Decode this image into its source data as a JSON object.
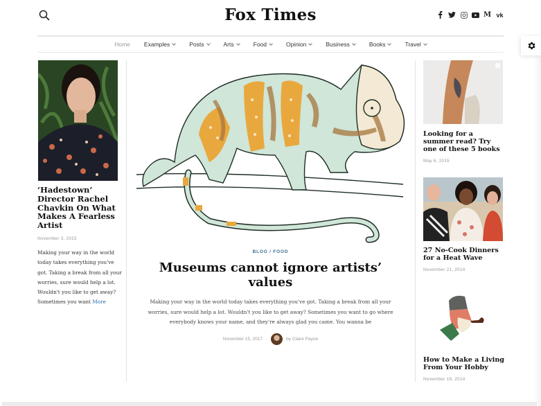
{
  "header": {
    "logo": "Fox Times",
    "search_icon": "search-icon",
    "social": [
      {
        "name": "facebook-icon",
        "glyph": "f"
      },
      {
        "name": "twitter-icon",
        "glyph": "t"
      },
      {
        "name": "instagram-icon",
        "glyph": "i"
      },
      {
        "name": "youtube-icon",
        "glyph": "y"
      },
      {
        "name": "medium-icon",
        "glyph": "M"
      },
      {
        "name": "vk-icon",
        "glyph": "vk"
      }
    ]
  },
  "nav": {
    "items": [
      {
        "label": "Home",
        "dropdown": false
      },
      {
        "label": "Examples",
        "dropdown": true
      },
      {
        "label": "Posts",
        "dropdown": true
      },
      {
        "label": "Arts",
        "dropdown": true
      },
      {
        "label": "Food",
        "dropdown": true
      },
      {
        "label": "Opinion",
        "dropdown": true
      },
      {
        "label": "Business",
        "dropdown": true
      },
      {
        "label": "Books",
        "dropdown": true
      },
      {
        "label": "Travel",
        "dropdown": true
      }
    ]
  },
  "settings": {
    "icon": "gear-icon"
  },
  "left_post": {
    "title": "‘Hadestown’ Director Rachel Chavkin On What Makes A Fearless Artist",
    "date": "November 3, 2015",
    "excerpt": "Making your way in the world today takes everything you've got. Taking a break from all your worries, sure would help a lot. Wouldn't you like to get away? Sometimes you want",
    "more_label": "More"
  },
  "main_post": {
    "category_1": "BLOG",
    "category_sep": " / ",
    "category_2": "FOOD",
    "title": "Museums cannot ignore artists’ values",
    "excerpt": "Making your way in the world today takes everything you've got. Taking a break from all your worries, sure would help a lot. Wouldn't you like to get away? Sometimes you want to go where everybody knows your name, and they're always glad you came. You wanna be",
    "date": "November 15, 2017",
    "date_sep": "·",
    "author": "by Claire Payne"
  },
  "right_posts": [
    {
      "title": "Looking for a summer read? Try one of these 5 books",
      "date": "May 6, 2015"
    },
    {
      "title": "27 No-Cook Dinners for a Heat Wave",
      "date": "November 21, 2014"
    },
    {
      "title": "How to Make a Living From Your Hobby",
      "date": "November 19, 2014"
    }
  ]
}
